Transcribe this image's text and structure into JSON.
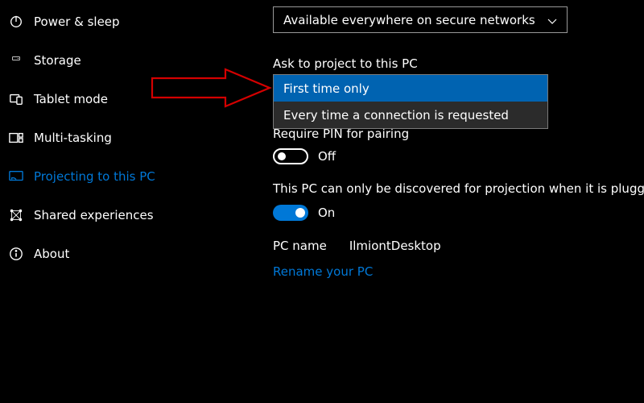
{
  "sidebar": {
    "items": [
      {
        "label": "Power & sleep",
        "icon": "power"
      },
      {
        "label": "Storage",
        "icon": "storage"
      },
      {
        "label": "Tablet mode",
        "icon": "tablet"
      },
      {
        "label": "Multi-tasking",
        "icon": "multitask"
      },
      {
        "label": "Projecting to this PC",
        "icon": "project"
      },
      {
        "label": "Shared experiences",
        "icon": "shared"
      },
      {
        "label": "About",
        "icon": "about"
      }
    ],
    "active_index": 4
  },
  "main": {
    "network_select": {
      "value": "Available everywhere on secure networks"
    },
    "ask_label": "Ask to project to this PC",
    "ask_options": [
      "First time only",
      "Every time a connection is requested"
    ],
    "ask_selected_index": 0,
    "pin_label": "Require PIN for pairing",
    "pin_toggle": {
      "state": "Off",
      "on": false
    },
    "discover_label": "This PC can only be discovered for projection when it is plugged in",
    "discover_toggle": {
      "state": "On",
      "on": true
    },
    "pcname_label": "PC name",
    "pcname_value": "IlmiontDesktop",
    "rename_link": "Rename your PC"
  }
}
